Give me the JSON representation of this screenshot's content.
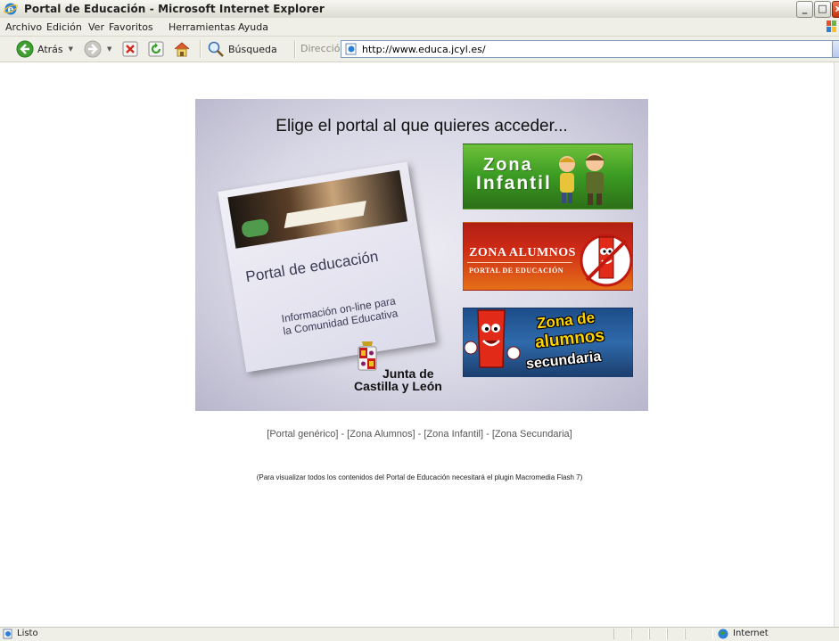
{
  "window": {
    "title": "Portal de Educación - Microsoft Internet Explorer",
    "min_glyph": "_",
    "max_glyph": "□",
    "close_glyph": "x"
  },
  "menu": [
    "Archivo",
    "Edición",
    "Ver",
    "Favoritos",
    "Herramientas",
    "Ayuda"
  ],
  "toolbar": {
    "back_label": "Atrás",
    "search_label": "Búsqueda",
    "address_label": "Dirección",
    "url": "http://www.educa.jcyl.es/"
  },
  "page": {
    "heading": "Elige el portal al que quieres acceder...",
    "card_title": "Portal de educación",
    "card_subtitle_1": "Información on-line para",
    "card_subtitle_2": "la Comunidad Educativa",
    "infantil_line1": "Zona",
    "infantil_line2": "Infantil",
    "alumnos_line1": "ZONA ALUMNOS",
    "alumnos_line2": "PORTAL DE EDUCACIÓN",
    "secundaria_line1": "Zona de",
    "secundaria_line2": "alumnos",
    "secundaria_line3": "secundaria",
    "logo_line1": "Junta de",
    "logo_line2": "Castilla y León",
    "links": [
      "[Portal genérico]",
      "[Zona Alumnos]",
      "[Zona Infantil]",
      "[Zona Secundaria]"
    ],
    "link_separator": " - ",
    "notice": "(Para visualizar todos los contenidos del Portal de Educación necesitará el plugin Macromedia Flash 7)"
  },
  "status": {
    "text": "Listo",
    "zone": "Internet"
  },
  "colors": {
    "titlebar": "#e9e8df",
    "infantil": "#3a9a22",
    "alumnos": "#cf2a16",
    "secundaria": "#2f6aab"
  }
}
